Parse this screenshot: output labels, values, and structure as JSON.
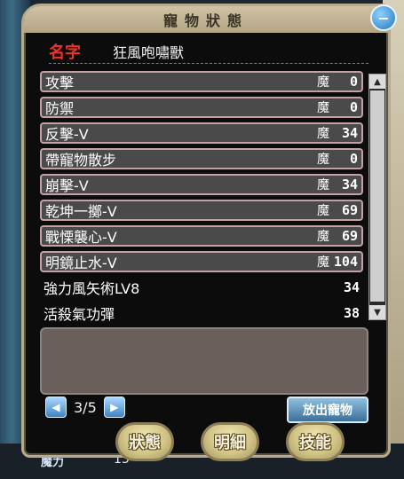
{
  "window": {
    "title": "寵物狀態"
  },
  "pet": {
    "name_label": "名字",
    "name": "狂風咆嘯獸"
  },
  "skills": [
    {
      "name": "攻擊",
      "mp_label": "魔",
      "mp": "0",
      "boxed": true
    },
    {
      "name": "防禦",
      "mp_label": "魔",
      "mp": "0",
      "boxed": true
    },
    {
      "name": "反擊-Ⅴ",
      "mp_label": "魔",
      "mp": "34",
      "boxed": true
    },
    {
      "name": "帶寵物散步",
      "mp_label": "魔",
      "mp": "0",
      "boxed": true
    },
    {
      "name": "崩擊-Ⅴ",
      "mp_label": "魔",
      "mp": "34",
      "boxed": true
    },
    {
      "name": "乾坤一擲-Ⅴ",
      "mp_label": "魔",
      "mp": "69",
      "boxed": true
    },
    {
      "name": "戰慄襲心-Ⅴ",
      "mp_label": "魔",
      "mp": "69",
      "boxed": true
    },
    {
      "name": "明鏡止水-Ⅴ",
      "mp_label": "魔",
      "mp": "104",
      "boxed": true
    },
    {
      "name": "強力風矢術LV8",
      "mp_label": "",
      "mp": "34",
      "boxed": false
    },
    {
      "name": "活殺氣功彈",
      "mp_label": "",
      "mp": "38",
      "boxed": false
    }
  ],
  "pager": {
    "current": "3/5"
  },
  "buttons": {
    "release": "放出寵物"
  },
  "tabs": [
    "狀態",
    "明細",
    "技能"
  ],
  "background": {
    "label": "魔力",
    "value": "13"
  }
}
